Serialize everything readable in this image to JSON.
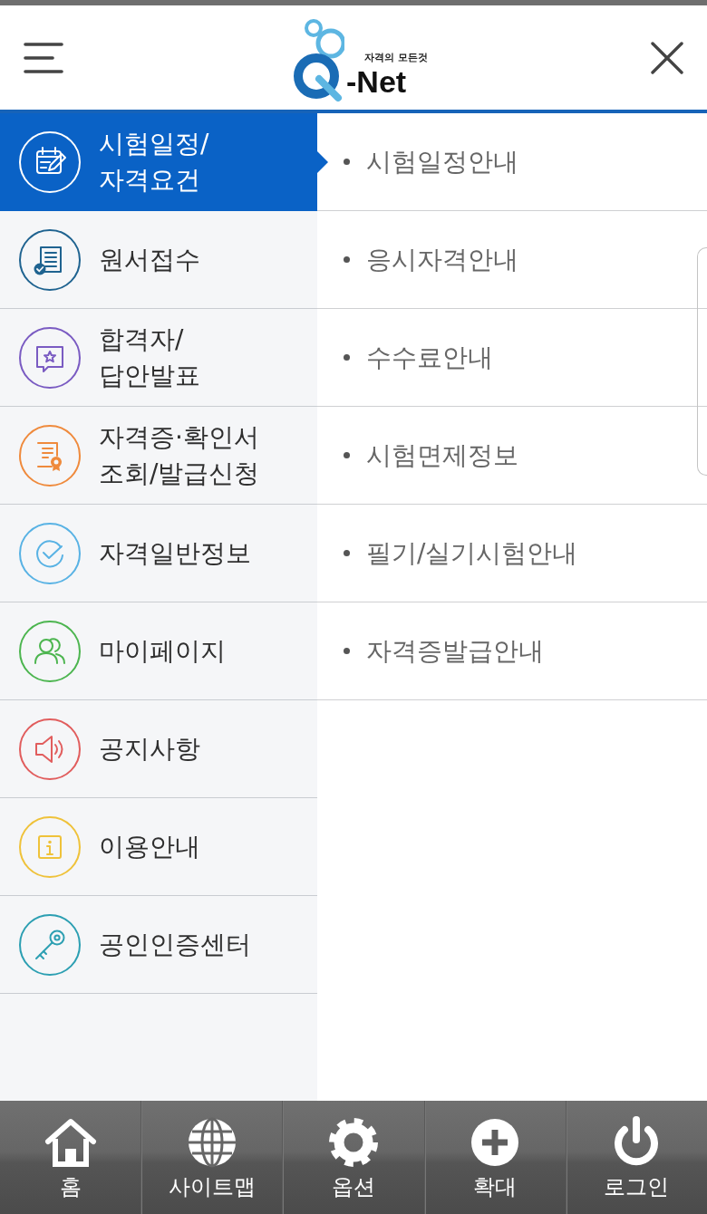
{
  "header": {
    "logo": {
      "tagline": "자격의 모든것",
      "wordmark": "-Net"
    }
  },
  "menu": {
    "items": [
      {
        "label": "시험일정/\n자격요건",
        "kind": "calendar",
        "color": "#ffffff",
        "selected": true
      },
      {
        "label": "원서접수",
        "kind": "form",
        "color": "#1f6390",
        "selected": false
      },
      {
        "label": "합격자/\n답안발표",
        "kind": "speech",
        "color": "#7a5bc2",
        "selected": false
      },
      {
        "label": "자격증·확인서\n조회/발급신청",
        "kind": "certificate",
        "color": "#ef8a3c",
        "selected": false
      },
      {
        "label": "자격일반정보",
        "kind": "check",
        "color": "#58b2e4",
        "selected": false
      },
      {
        "label": "마이페이지",
        "kind": "people",
        "color": "#4cb54f",
        "selected": false
      },
      {
        "label": "공지사항",
        "kind": "speaker",
        "color": "#e15d5d",
        "selected": false
      },
      {
        "label": "이용안내",
        "kind": "info",
        "color": "#efc23a",
        "selected": false
      },
      {
        "label": "공인인증센터",
        "kind": "key",
        "color": "#2c9fb2",
        "selected": false
      }
    ]
  },
  "submenu": {
    "items": [
      {
        "label": "시험일정안내"
      },
      {
        "label": "응시자격안내"
      },
      {
        "label": "수수료안내"
      },
      {
        "label": "시험면제정보"
      },
      {
        "label": "필기/실기시험안내"
      },
      {
        "label": "자격증발급안내"
      }
    ]
  },
  "bottom_nav": {
    "items": [
      {
        "kind": "home",
        "label": "홈"
      },
      {
        "kind": "globe",
        "label": "사이트맵"
      },
      {
        "kind": "gear",
        "label": "옵션"
      },
      {
        "kind": "plus",
        "label": "확대"
      },
      {
        "kind": "power",
        "label": "로그인"
      }
    ]
  }
}
